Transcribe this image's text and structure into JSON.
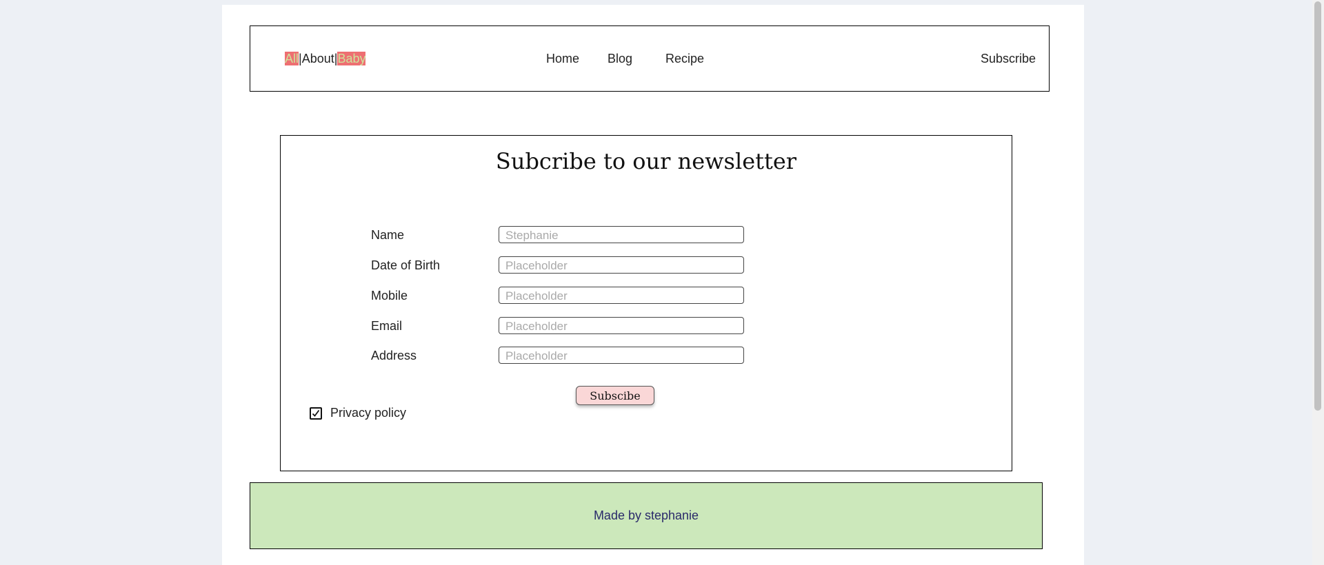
{
  "header": {
    "logo": {
      "part1": "All",
      "sep1": "|",
      "part2": "About",
      "sep2": "|",
      "part3": "Baby"
    },
    "nav": {
      "home": "Home",
      "blog": "Blog",
      "recipe": "Recipe",
      "subscribe": "Subscribe"
    }
  },
  "form": {
    "title": "Subcribe to our newsletter",
    "fields": [
      {
        "label": "Name",
        "placeholder": "Stephanie"
      },
      {
        "label": "Date of Birth",
        "placeholder": "Placeholder"
      },
      {
        "label": "Mobile",
        "placeholder": "Placeholder"
      },
      {
        "label": "Email",
        "placeholder": "Placeholder"
      },
      {
        "label": "Address",
        "placeholder": "Placeholder"
      }
    ],
    "submit_label": "Subscibe",
    "privacy_label": "Privacy policy",
    "privacy_checked": true
  },
  "footer": {
    "text": "Made by stephanie"
  },
  "colors": {
    "background": "#edf0f5",
    "logo_highlight_bg": "#ee6f72",
    "logo_highlight_text": "#cfe39b",
    "button_bg": "#fad7d7",
    "footer_bg": "#cce8bb"
  },
  "icons": {
    "checkbox": "checkmark-icon"
  }
}
